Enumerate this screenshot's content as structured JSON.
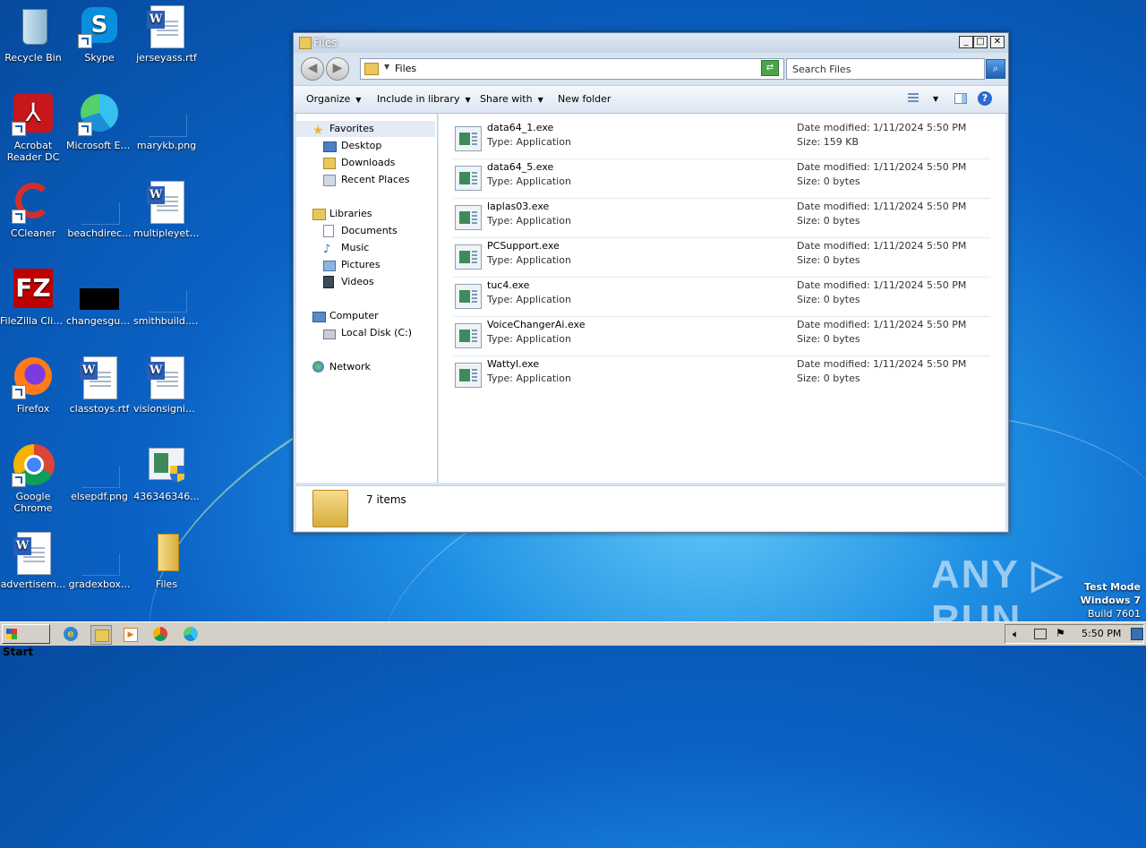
{
  "desktop": {
    "icons": [
      {
        "label": "Recycle Bin"
      },
      {
        "label": "Skype"
      },
      {
        "label": "jerseyass.rtf"
      },
      {
        "label": "Acrobat Reader DC"
      },
      {
        "label": "Microsoft Edge"
      },
      {
        "label": "marykb.png"
      },
      {
        "label": "CCleaner"
      },
      {
        "label": "beachdirec..."
      },
      {
        "label": "multipleyet.rtf"
      },
      {
        "label": "FileZilla Client"
      },
      {
        "label": "changesguy..."
      },
      {
        "label": "smithbuild.png"
      },
      {
        "label": "Firefox"
      },
      {
        "label": "classtoys.rtf"
      },
      {
        "label": "visionsignific..."
      },
      {
        "label": "Google Chrome"
      },
      {
        "label": "elsepdf.png"
      },
      {
        "label": "436346346..."
      },
      {
        "label": "advertisem..."
      },
      {
        "label": "gradexbox..."
      },
      {
        "label": "Files"
      }
    ],
    "watermark": "ANY ▷ RUN",
    "test_mode": {
      "line1": "Test Mode",
      "line2": "Windows 7",
      "line3": "Build 7601"
    }
  },
  "window": {
    "title": "Files",
    "address": "Files",
    "search_placeholder": "Search Files",
    "toolbar": {
      "organize": "Organize",
      "include": "Include in library",
      "share": "Share with",
      "new_folder": "New folder"
    },
    "nav": {
      "favorites": "Favorites",
      "desktop": "Desktop",
      "downloads": "Downloads",
      "recent": "Recent Places",
      "libraries": "Libraries",
      "documents": "Documents",
      "music": "Music",
      "pictures": "Pictures",
      "videos": "Videos",
      "computer": "Computer",
      "local_disk": "Local Disk (C:)",
      "network": "Network"
    },
    "files": [
      {
        "name": "data64_1.exe",
        "type": "Type: Application",
        "date": "Date modified: 1/11/2024 5:50 PM",
        "size": "Size: 159 KB"
      },
      {
        "name": "data64_5.exe",
        "type": "Type: Application",
        "date": "Date modified: 1/11/2024 5:50 PM",
        "size": "Size: 0 bytes"
      },
      {
        "name": "laplas03.exe",
        "type": "Type: Application",
        "date": "Date modified: 1/11/2024 5:50 PM",
        "size": "Size: 0 bytes"
      },
      {
        "name": "PCSupport.exe",
        "type": "Type: Application",
        "date": "Date modified: 1/11/2024 5:50 PM",
        "size": "Size: 0 bytes"
      },
      {
        "name": "tuc4.exe",
        "type": "Type: Application",
        "date": "Date modified: 1/11/2024 5:50 PM",
        "size": "Size: 0 bytes"
      },
      {
        "name": "VoiceChangerAi.exe",
        "type": "Type: Application",
        "date": "Date modified: 1/11/2024 5:50 PM",
        "size": "Size: 0 bytes"
      },
      {
        "name": "Wattyl.exe",
        "type": "Type: Application",
        "date": "Date modified: 1/11/2024 5:50 PM",
        "size": "Size: 0 bytes"
      }
    ],
    "item_count": "7 items"
  },
  "taskbar": {
    "start": "Start",
    "clock": "5:50 PM"
  }
}
